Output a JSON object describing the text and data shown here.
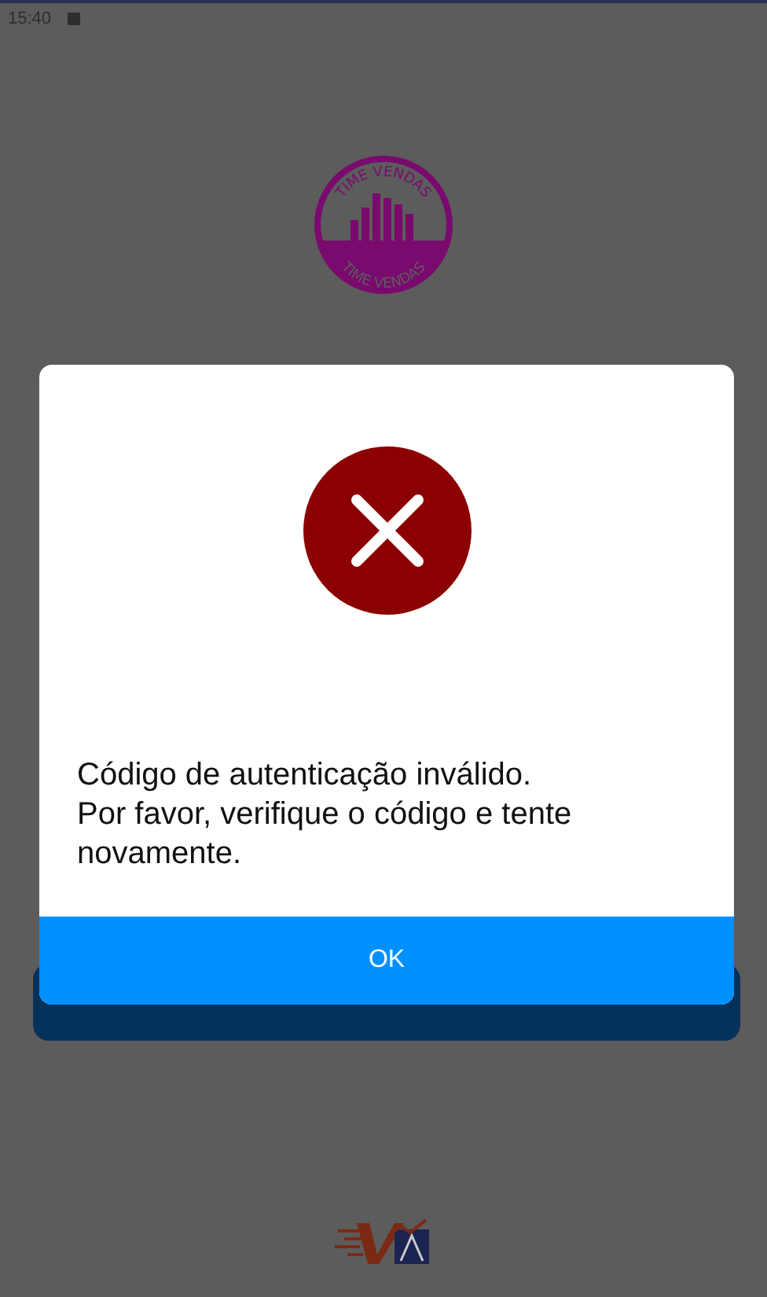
{
  "status_bar": {
    "time": "15:40"
  },
  "logo": {
    "top_text": "TIME VENDAS",
    "bottom_text": "TIME VENDAS"
  },
  "dialog": {
    "message": "Código de autenticação inválido.\nPor favor, verifique o código e tente novamente.",
    "button": "OK"
  }
}
